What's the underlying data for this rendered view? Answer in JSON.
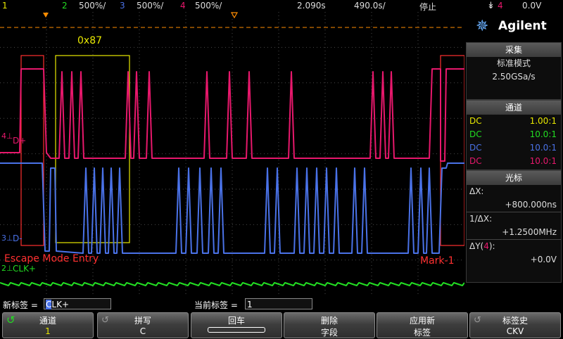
{
  "topbar": {
    "ch1": "1",
    "ch2": "2",
    "ch2_scale": "500%/",
    "ch3": "3",
    "ch3_scale": "500%/",
    "ch4": "4",
    "ch4_scale": "500%/",
    "time_pos": "2.090s",
    "time_div": "490.0s/",
    "run_state": "停止",
    "trig_ch": "4",
    "trig_level": "0.0V"
  },
  "screen": {
    "decode_label": "0x87",
    "mark_escape": "Escape Mode Entry",
    "mark_1": "Mark-1",
    "trace_dplus": "D+",
    "trace_dminus": "D-",
    "trace_clk": "CLK+",
    "ch4_marker": "4",
    "ch3_marker": "3",
    "ch2_marker": "2"
  },
  "panel": {
    "brand": "Agilent",
    "acq_header": "采集",
    "acq_mode": "标准模式",
    "acq_rate": "2.50GSa/s",
    "chan_header": "通道",
    "channels": [
      {
        "coupling": "DC",
        "probe": "1.00:1",
        "color": "#e8e800"
      },
      {
        "coupling": "DC",
        "probe": "10.0:1",
        "color": "#22dd22"
      },
      {
        "coupling": "DC",
        "probe": "10.0:1",
        "color": "#4a72e8"
      },
      {
        "coupling": "DC",
        "probe": "10.0:1",
        "color": "#e8186c"
      }
    ],
    "cursor_header": "光标",
    "dx_label": "ΔX:",
    "dx_value": "+800.000ns",
    "inv_dx_label": "1/ΔX:",
    "inv_dx_value": "+1.2500MHz",
    "dy_label_pre": "ΔY(",
    "dy_ch": "4",
    "dy_label_post": "):",
    "dy_value": "+0.0V"
  },
  "labelbar": {
    "new_label_prompt": "新标签 =",
    "new_label_value": "CLK+",
    "current_label_prompt": "当前标签 =",
    "current_label_value": "1"
  },
  "softkeys": [
    {
      "line1": "通道",
      "line2": "1"
    },
    {
      "line1": "拼写",
      "line2": "C"
    },
    {
      "line1": "回车",
      "line2": ""
    },
    {
      "line1": "删除",
      "line2": "字段"
    },
    {
      "line1": "应用新",
      "line2": "标签"
    },
    {
      "line1": "标签史",
      "line2": "CKV"
    }
  ],
  "colors": {
    "ch1": "#e8e800",
    "ch2": "#22dd22",
    "ch3": "#4a72e8",
    "ch4": "#e8186c",
    "trigger": "#ff8c00",
    "marker": "#ff3030"
  }
}
